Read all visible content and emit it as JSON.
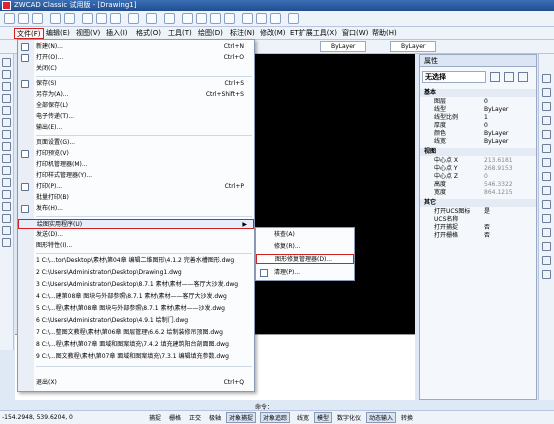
{
  "window": {
    "title": "ZWCAD Classic 试用版 - [Drawing1]"
  },
  "menubar": [
    "文件(F)",
    "编辑(E)",
    "视图(V)",
    "插入(I)",
    "格式(O)",
    "工具(T)",
    "绘图(D)",
    "标注(N)",
    "修改(M)",
    "ET扩展工具(X)",
    "窗口(W)",
    "帮助(H)"
  ],
  "layers": {
    "layer1": "ByLayer",
    "layer2": "ByLayer"
  },
  "file_menu": [
    {
      "label": "新建(N)...",
      "shortcut": "Ctrl+N"
    },
    {
      "label": "打开(O)...",
      "shortcut": "Ctrl+O"
    },
    {
      "label": "关闭(C)",
      "shortcut": ""
    },
    {
      "label": "保存(S)",
      "shortcut": "Ctrl+S"
    },
    {
      "label": "另存为(A)...",
      "shortcut": "Ctrl+Shift+S"
    },
    {
      "label": "全部保存(L)",
      "shortcut": ""
    },
    {
      "label": "电子传递(T)...",
      "shortcut": ""
    },
    {
      "label": "输出(E)...",
      "shortcut": ""
    },
    {
      "label": "页面设置(G)...",
      "shortcut": ""
    },
    {
      "label": "打印预览(V)",
      "shortcut": ""
    },
    {
      "label": "打印机管理器(M)...",
      "shortcut": ""
    },
    {
      "label": "打印样式管理器(Y)...",
      "shortcut": ""
    },
    {
      "label": "打印(P)...",
      "shortcut": "Ctrl+P"
    },
    {
      "label": "批量打印(B)",
      "shortcut": ""
    },
    {
      "label": "发布(H)...",
      "shortcut": ""
    },
    {
      "label": "绘图实用程序(U)",
      "shortcut": ""
    },
    {
      "label": "发送(D)...",
      "shortcut": ""
    },
    {
      "label": "图形特性(I)...",
      "shortcut": ""
    },
    {
      "label": "1 C:\\...tor\\Desktop\\素材\\第04章 编辑二维图形\\4.1.2 完善水槽图形.dwg",
      "shortcut": ""
    },
    {
      "label": "2 C:\\Users\\Administrator\\Desktop\\Drawing1.dwg",
      "shortcut": ""
    },
    {
      "label": "3 C:\\Users\\Administrator\\Desktop\\8.7.1 素材\\素材——客厅大沙发.dwg",
      "shortcut": ""
    },
    {
      "label": "4 C:\\...建第08章 图块与外部参照\\8.7.1 素材\\素材——客厅大沙发.dwg",
      "shortcut": ""
    },
    {
      "label": "5 C:\\...程\\素材\\第08章 图块与外部参照\\8.7.1 素材\\素材——沙发.dwg",
      "shortcut": ""
    },
    {
      "label": "6 C:\\Users\\Administrator\\Desktop\\4.9.1 绘制门.dwg",
      "shortcut": ""
    },
    {
      "label": "7 C:\\...整图文教程\\素材\\第06章 图层管理\\6.6.2 绘制装修吊顶图.dwg",
      "shortcut": ""
    },
    {
      "label": "8 C:\\...程\\素材\\第07章 面域和图案填充\\7.4.2 填充建筑阳台剖面图.dwg",
      "shortcut": ""
    },
    {
      "label": "9 C:\\...图文教程\\素材\\第07章 面域和图案填充\\7.3.1 编辑填充参数.dwg",
      "shortcut": ""
    },
    {
      "label": "退出(X)",
      "shortcut": "Ctrl+Q"
    }
  ],
  "submenu": [
    {
      "label": "核查(A)"
    },
    {
      "label": "修复(R)..."
    },
    {
      "label": "图形修复管理器(D)..."
    },
    {
      "label": "清理(P)..."
    }
  ],
  "properties": {
    "title": "属性",
    "selector": "无选择",
    "sec_basic": "基本",
    "basic": [
      {
        "k": "图层",
        "v": "0"
      },
      {
        "k": "线型",
        "v": "ByLayer"
      },
      {
        "k": "线型比例",
        "v": "1"
      },
      {
        "k": "厚度",
        "v": "0"
      },
      {
        "k": "颜色",
        "v": "ByLayer"
      },
      {
        "k": "线宽",
        "v": "ByLayer"
      }
    ],
    "sec_view": "视图",
    "view": [
      {
        "k": "中心点 X",
        "v": "213.6181"
      },
      {
        "k": "中心点 Y",
        "v": "268.9153"
      },
      {
        "k": "中心点 Z",
        "v": "0"
      },
      {
        "k": "高度",
        "v": "546.3322"
      },
      {
        "k": "宽度",
        "v": "864.1215"
      }
    ],
    "sec_other": "其它",
    "other": [
      {
        "k": "打开UCS图标",
        "v": "是"
      },
      {
        "k": "UCS名称",
        "v": ""
      },
      {
        "k": "打开捕捉",
        "v": "否"
      },
      {
        "k": "打开栅格",
        "v": "否"
      }
    ]
  },
  "command": {
    "prompt": "命令："
  },
  "status": {
    "coords": "-154.2948, 539.6204, 0",
    "buttons": [
      "捕捉",
      "栅格",
      "正交",
      "极轴",
      "对象捕捉",
      "对象追踪",
      "线宽",
      "模型",
      "数字化仪",
      "动态输入",
      "转换"
    ]
  }
}
